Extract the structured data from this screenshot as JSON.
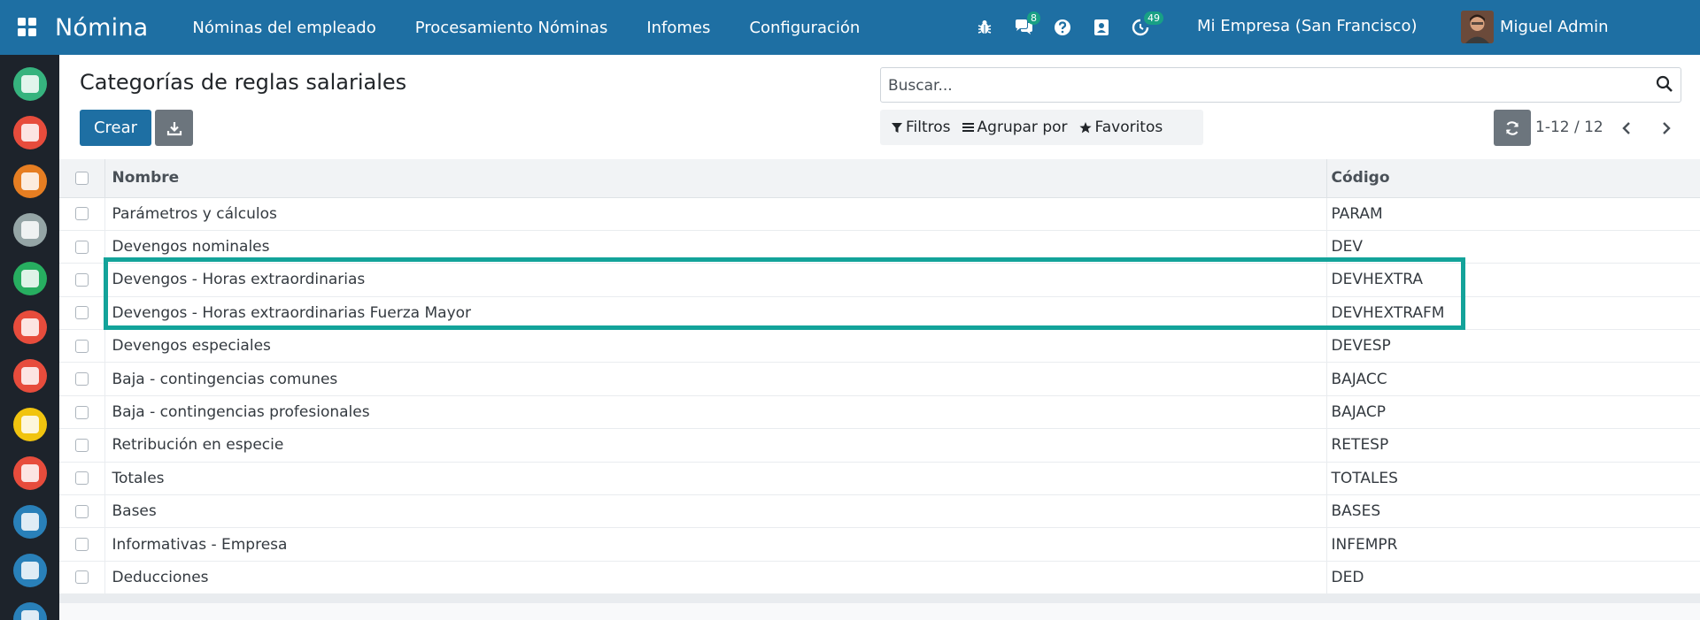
{
  "navbar": {
    "brand": "Nómina",
    "menu": [
      "Nóminas del empleado",
      "Procesamiento Nóminas",
      "Infomes",
      "Configuración"
    ],
    "systray": {
      "messages_badge": "8",
      "activities_badge": "49"
    },
    "company": "Mi Empresa (San Francisco)",
    "user_name": "Miguel Admin"
  },
  "sidebar_apps": [
    {
      "name": "discuss",
      "color": "#36b37e"
    },
    {
      "name": "calendar",
      "color": "#e74c3c"
    },
    {
      "name": "notes",
      "color": "#e67e22"
    },
    {
      "name": "contacts",
      "color": "#95a5a6"
    },
    {
      "name": "employees",
      "color": "#27ae60"
    },
    {
      "name": "recruitment",
      "color": "#e74c3c"
    },
    {
      "name": "reporting",
      "color": "#e74c3c"
    },
    {
      "name": "presentation",
      "color": "#f1c40f"
    },
    {
      "name": "payroll",
      "color": "#e74c3c"
    },
    {
      "name": "pos",
      "color": "#2980b9"
    },
    {
      "name": "calculator",
      "color": "#2980b9"
    },
    {
      "name": "planning",
      "color": "#2980b9"
    }
  ],
  "page": {
    "title": "Categorías de reglas salariales",
    "create_label": "Crear",
    "search_placeholder": "Buscar...",
    "filters_label": "Filtros",
    "group_by_label": "Agrupar por",
    "favorites_label": "Favoritos",
    "pager": "1-12 / 12"
  },
  "table": {
    "columns": [
      "Nombre",
      "Código"
    ],
    "rows": [
      {
        "name": "Parámetros y cálculos",
        "code": "PARAM"
      },
      {
        "name": "Devengos nominales",
        "code": "DEV"
      },
      {
        "name": "Devengos - Horas extraordinarias",
        "code": "DEVHEXTRA"
      },
      {
        "name": "Devengos - Horas extraordinarias Fuerza Mayor",
        "code": "DEVHEXTRAFM"
      },
      {
        "name": "Devengos especiales",
        "code": "DEVESP"
      },
      {
        "name": "Baja - contingencias comunes",
        "code": "BAJACC"
      },
      {
        "name": "Baja - contingencias profesionales",
        "code": "BAJACP"
      },
      {
        "name": "Retribución en especie",
        "code": "RETESP"
      },
      {
        "name": "Totales",
        "code": "TOTALES"
      },
      {
        "name": "Bases",
        "code": "BASES"
      },
      {
        "name": "Informativas - Empresa",
        "code": "INFEMPR"
      },
      {
        "name": "Deducciones",
        "code": "DED"
      }
    ]
  },
  "colors": {
    "navbar": "#1e6fa3",
    "highlight": "#13a39a",
    "badge": "#18a085"
  }
}
